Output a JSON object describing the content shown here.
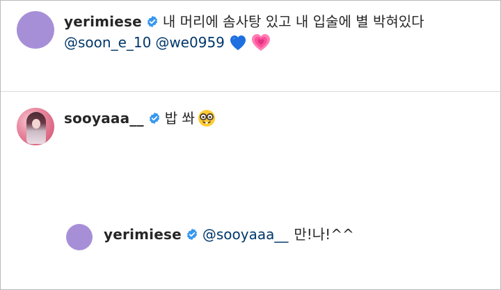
{
  "comments": [
    {
      "username": "yerimiese",
      "text": "내 머리에 솜사탕 있고 내 입술에 별 박혀있다",
      "mentions": [
        "@soon_e_10",
        "@we0959"
      ],
      "emojis": [
        "blue-heart",
        "growing-heart"
      ],
      "avatar": "purple-placeholder"
    },
    {
      "username": "sooyaaa__",
      "text": "밥 쏴",
      "emojis": [
        "nerd-face"
      ],
      "avatar": "profile-photo"
    },
    {
      "username": "yerimiese",
      "mention": "@sooyaaa__",
      "text": "만!나!^^",
      "avatar": "purple-placeholder",
      "is_reply": true
    }
  ],
  "colors": {
    "verified_badge": "#3897f0",
    "mention": "#00376b",
    "avatar_placeholder": "#a78fd8",
    "divider": "#dbdbdb"
  }
}
